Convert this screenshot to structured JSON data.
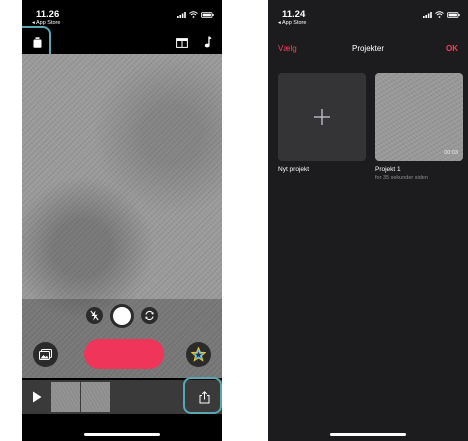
{
  "left_phone": {
    "status": {
      "time": "11.26",
      "back_label": "◂ App Store"
    },
    "icons": {
      "project": "trash-icon",
      "aspect": "aspect-ratio-icon",
      "music": "music-note-icon",
      "flash": "flash-off-icon",
      "shutter": "shutter-icon",
      "flip": "flip-camera-icon",
      "gallery": "gallery-icon",
      "effects": "star-effects-icon",
      "play": "play-icon",
      "share": "share-icon"
    },
    "colors": {
      "record": "#f0355a",
      "highlight": "#5aa7b4"
    }
  },
  "right_phone": {
    "status": {
      "time": "11.24",
      "back_label": "◂ App Store"
    },
    "nav": {
      "left": "Vælg",
      "title": "Projekter",
      "right": "OK"
    },
    "projects": [
      {
        "label": "Nyt projekt"
      },
      {
        "label": "Projekt 1",
        "subtitle": "for 35 sekunder siden",
        "duration": "00:03"
      }
    ],
    "colors": {
      "accent": "#ff3b5c"
    }
  }
}
